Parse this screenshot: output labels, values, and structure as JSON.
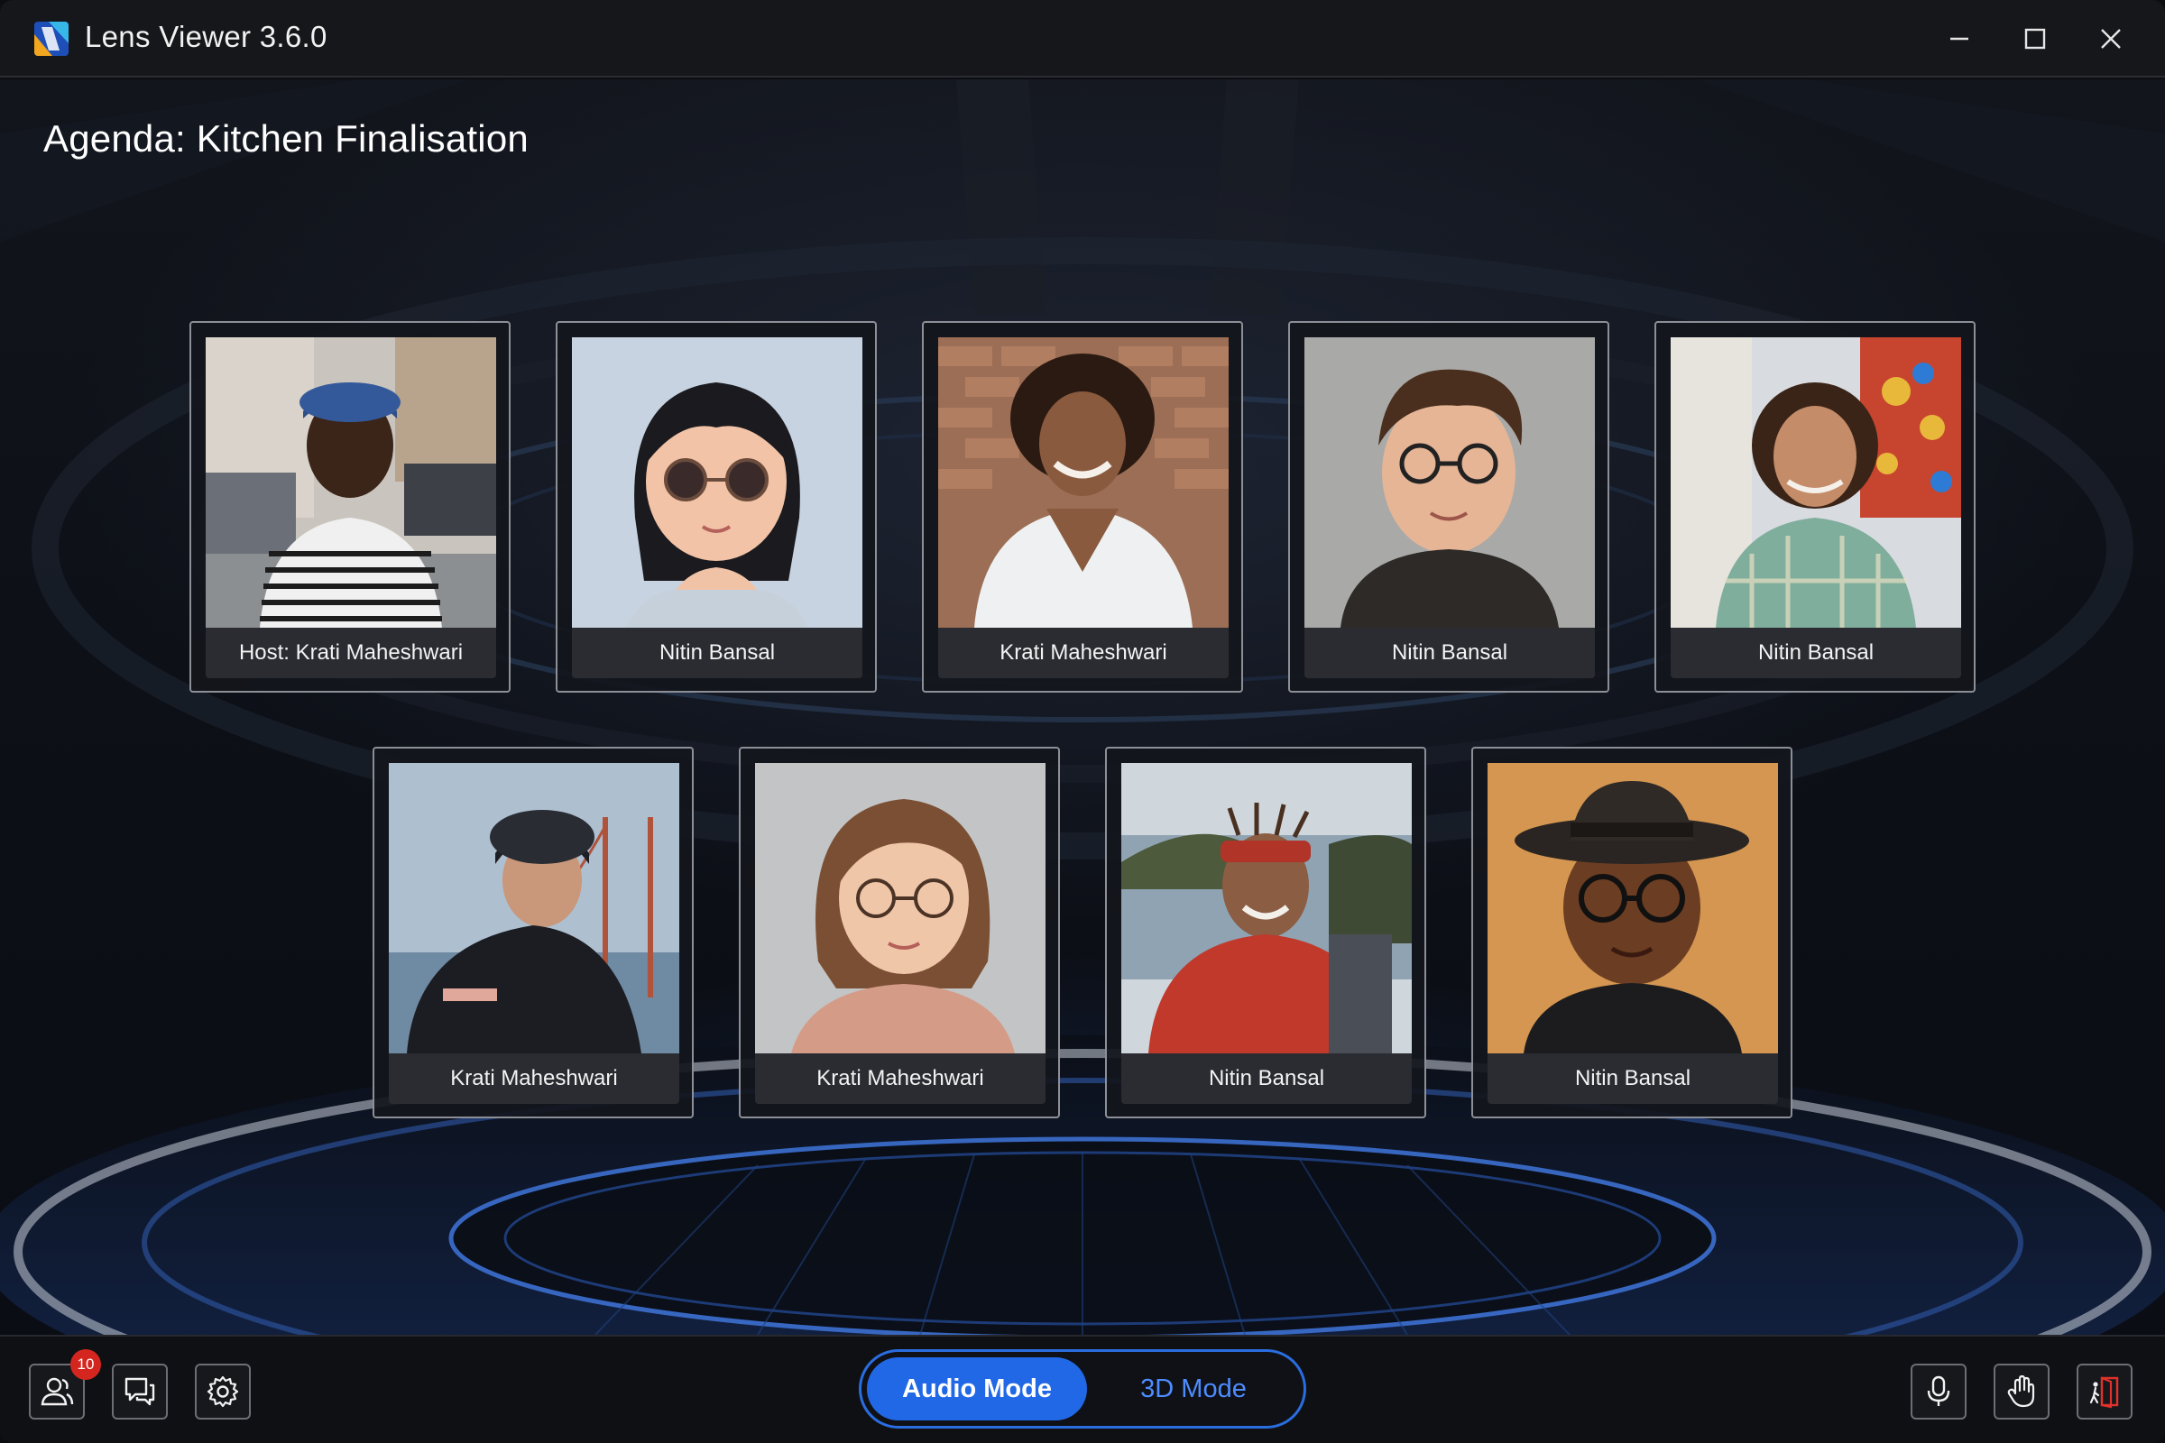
{
  "window": {
    "title": "Lens Viewer 3.6.0",
    "logo_icon": "lens-viewer-logo-icon",
    "controls": [
      "minimize-icon",
      "maximize-icon",
      "close-icon"
    ]
  },
  "meeting": {
    "agenda": "Agenda: Kitchen Finalisation"
  },
  "participants": [
    {
      "name": "Host: Krati Maheshwari",
      "avatar": "photo-man-striped-shirt-cap"
    },
    {
      "name": "Nitin Bansal",
      "avatar": "cartoon-woman-glasses"
    },
    {
      "name": "Krati Maheshwari",
      "avatar": "photo-man-curly-hair-laughing"
    },
    {
      "name": "Nitin Bansal",
      "avatar": "cartoon-young-man-glasses"
    },
    {
      "name": "Nitin Bansal",
      "avatar": "photo-man-plaid-shirt-market"
    },
    {
      "name": "Krati Maheshwari",
      "avatar": "photo-cyclist-helmet-bridge"
    },
    {
      "name": "Krati Maheshwari",
      "avatar": "cartoon-woman-bob-glasses"
    },
    {
      "name": "Nitin Bansal",
      "avatar": "photo-man-headband-lake"
    },
    {
      "name": "Nitin Bansal",
      "avatar": "cartoon-man-hat-glasses"
    }
  ],
  "toolbar": {
    "participants_icon": "participants-icon",
    "participants_count": "10",
    "chat_icon": "chat-icon",
    "settings_icon": "gear-icon",
    "mode_audio_label": "Audio Mode",
    "mode_3d_label": "3D Mode",
    "active_mode": "Audio Mode",
    "mic_icon": "microphone-icon",
    "raise_hand_icon": "raise-hand-icon",
    "leave_icon": "leave-meeting-icon"
  },
  "colors": {
    "accent": "#2168e6",
    "accent_text": "#4d8cff",
    "badge": "#d4261f",
    "leave": "#e0322b"
  }
}
